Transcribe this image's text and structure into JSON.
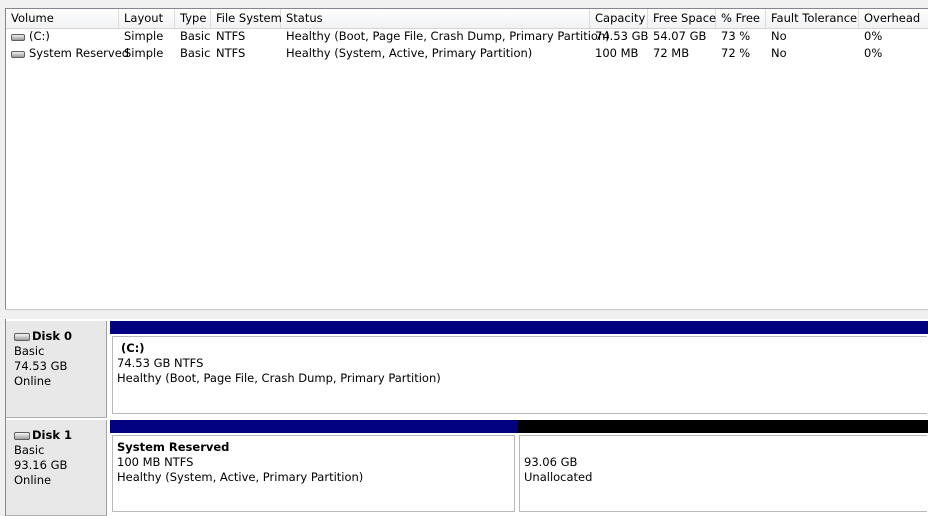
{
  "columns": [
    "Volume",
    "Layout",
    "Type",
    "File System",
    "Status",
    "Capacity",
    "Free Space",
    "% Free",
    "Fault Tolerance",
    "Overhead"
  ],
  "volumes": [
    {
      "icon": "drive-icon",
      "name": "(C:)",
      "layout": "Simple",
      "type": "Basic",
      "fs": "NTFS",
      "status": "Healthy (Boot, Page File, Crash Dump, Primary Partition)",
      "capacity": "74.53 GB",
      "free": "54.07 GB",
      "pct": "73 %",
      "fault": "No",
      "overhead": "0%"
    },
    {
      "icon": "drive-icon",
      "name": "System Reserved",
      "layout": "Simple",
      "type": "Basic",
      "fs": "NTFS",
      "status": "Healthy (System, Active, Primary Partition)",
      "capacity": "100 MB",
      "free": "72 MB",
      "pct": "72 %",
      "fault": "No",
      "overhead": "0%"
    }
  ],
  "disks": [
    {
      "name": "Disk 0",
      "type": "Basic",
      "size": "74.53 GB",
      "state": "Online",
      "partitions": [
        {
          "title": "(C:)",
          "size_fs": "74.53 GB NTFS",
          "status": "Healthy (Boot, Page File, Crash Dump, Primary Partition)"
        }
      ]
    },
    {
      "name": "Disk 1",
      "type": "Basic",
      "size": "93.16 GB",
      "state": "Online",
      "partitions": [
        {
          "title": "System Reserved",
          "size_fs": "100 MB NTFS",
          "status": "Healthy (System, Active, Primary Partition)"
        },
        {
          "title": "",
          "size_fs": "93.06 GB",
          "status": "Unallocated"
        }
      ]
    }
  ],
  "colors": {
    "primary_partition": "#000080",
    "unallocated": "#000000"
  }
}
